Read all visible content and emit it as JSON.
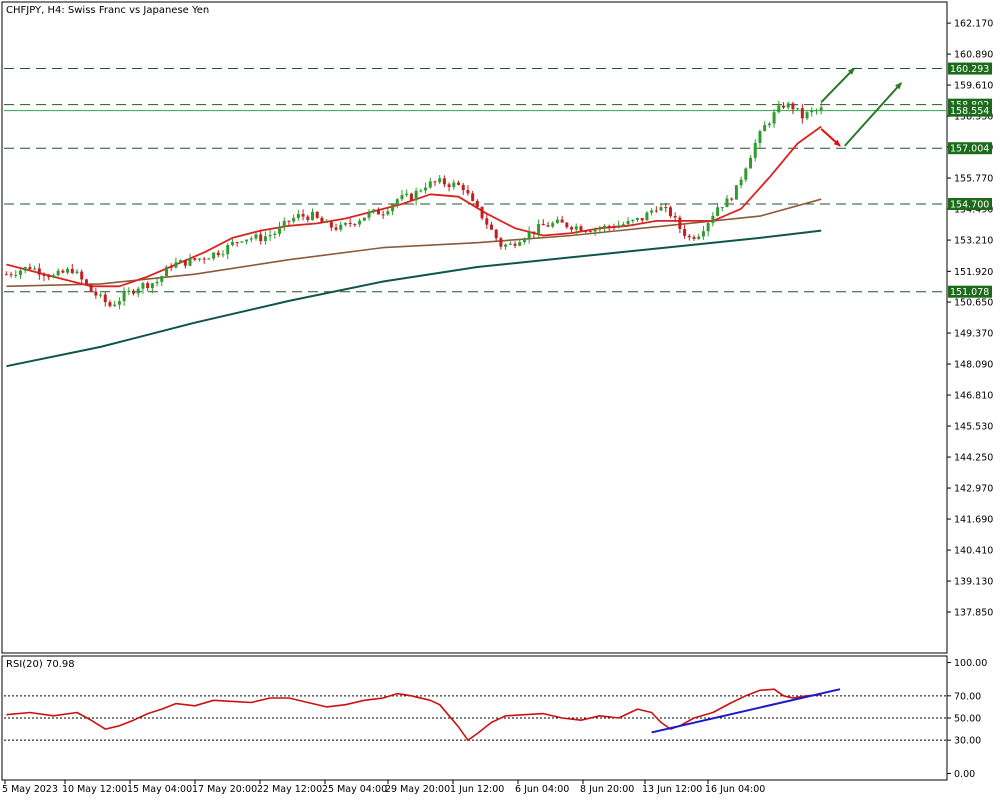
{
  "header": {
    "title": "CHFJPY, H4:  Swiss Franc vs Japanese Yen",
    "rsi_label": "RSI(20) 70.98"
  },
  "colors": {
    "bull": "#2e9d2e",
    "bear": "#c41e1e",
    "ma_fast": "#dd2222",
    "ma_mid": "#8b5a3c",
    "ma_slow": "#11544a",
    "level_line": "#1f5a2a",
    "level_label_bg": "#1b6b1b",
    "rsi_line": "#cc1111",
    "trend_line": "#1a1acc",
    "arrow_up": "#2a7a2a",
    "arrow_down": "#dd1111",
    "current_price_line": "#2fa64a"
  },
  "chart_data": {
    "type": "candlestick",
    "symbol": "CHFJPY",
    "timeframe": "H4",
    "ylim": [
      136.2,
      163.0
    ],
    "y_ticks": [
      "162.170",
      "160.890",
      "159.610",
      "158.330",
      "157.050",
      "155.770",
      "154.490",
      "153.210",
      "151.920",
      "150.650",
      "149.370",
      "148.090",
      "146.810",
      "145.530",
      "144.250",
      "142.970",
      "141.690",
      "140.410",
      "139.130",
      "137.850"
    ],
    "x_ticks": [
      "5 May 2023",
      "10 May 12:00",
      "15 May 04:00",
      "17 May 20:00",
      "22 May 12:00",
      "25 May 04:00",
      "29 May 20:00",
      "1 Jun 12:00",
      "6 Jun 04:00",
      "8 Jun 20:00",
      "13 Jun 12:00",
      "16 Jun 04:00"
    ],
    "levels": [
      {
        "value": 160.293,
        "label": "160.293"
      },
      {
        "value": 158.802,
        "label": "158.802"
      },
      {
        "value": 157.004,
        "label": "157.004"
      },
      {
        "value": 154.7,
        "label": "154.700"
      },
      {
        "value": 151.078,
        "label": "151.078"
      }
    ],
    "current_price": {
      "value": 158.554,
      "label": "158.554"
    },
    "close_path": [
      [
        0,
        151.8
      ],
      [
        5,
        152.1
      ],
      [
        10,
        151.7
      ],
      [
        14,
        152.0
      ],
      [
        18,
        151.1
      ],
      [
        22,
        150.5
      ],
      [
        25,
        150.9
      ],
      [
        28,
        151.3
      ],
      [
        32,
        151.5
      ],
      [
        35,
        152.2
      ],
      [
        38,
        152.3
      ],
      [
        42,
        152.5
      ],
      [
        46,
        152.8
      ],
      [
        50,
        153.3
      ],
      [
        54,
        153.3
      ],
      [
        57,
        153.5
      ],
      [
        60,
        154.0
      ],
      [
        62,
        154.2
      ],
      [
        65,
        154.2
      ],
      [
        68,
        153.8
      ],
      [
        71,
        153.7
      ],
      [
        74,
        154.0
      ],
      [
        77,
        154.3
      ],
      [
        80,
        154.4
      ],
      [
        83,
        154.9
      ],
      [
        86,
        155.0
      ],
      [
        89,
        155.5
      ],
      [
        92,
        155.6
      ],
      [
        95,
        155.5
      ],
      [
        97,
        155.4
      ],
      [
        99,
        154.7
      ],
      [
        101,
        154.2
      ],
      [
        103,
        153.6
      ],
      [
        105,
        153.0
      ],
      [
        107,
        153.0
      ],
      [
        109,
        153.3
      ],
      [
        111,
        153.5
      ],
      [
        114,
        153.8
      ],
      [
        117,
        153.9
      ],
      [
        120,
        153.8
      ],
      [
        123,
        153.7
      ],
      [
        126,
        153.7
      ],
      [
        129,
        153.8
      ],
      [
        132,
        153.9
      ],
      [
        135,
        154.1
      ],
      [
        138,
        154.6
      ],
      [
        141,
        154.3
      ],
      [
        143,
        153.7
      ],
      [
        145,
        153.3
      ],
      [
        147,
        153.5
      ],
      [
        149,
        154.0
      ],
      [
        151,
        154.6
      ],
      [
        153,
        154.8
      ],
      [
        155,
        155.3
      ],
      [
        157,
        156.3
      ],
      [
        159,
        157.2
      ],
      [
        161,
        157.9
      ],
      [
        163,
        158.4
      ],
      [
        165,
        158.8
      ],
      [
        167,
        158.7
      ],
      [
        169,
        158.3
      ],
      [
        171,
        158.5
      ],
      [
        173,
        158.6
      ]
    ],
    "ma_fast": [
      [
        0,
        152.2
      ],
      [
        6,
        151.9
      ],
      [
        12,
        151.6
      ],
      [
        18,
        151.3
      ],
      [
        24,
        151.3
      ],
      [
        30,
        151.7
      ],
      [
        36,
        152.2
      ],
      [
        42,
        152.7
      ],
      [
        48,
        153.3
      ],
      [
        54,
        153.6
      ],
      [
        60,
        153.8
      ],
      [
        66,
        153.9
      ],
      [
        72,
        154.1
      ],
      [
        78,
        154.4
      ],
      [
        84,
        154.7
      ],
      [
        90,
        155.1
      ],
      [
        96,
        155.0
      ],
      [
        102,
        154.3
      ],
      [
        108,
        153.7
      ],
      [
        114,
        153.4
      ],
      [
        120,
        153.5
      ],
      [
        126,
        153.7
      ],
      [
        132,
        153.8
      ],
      [
        138,
        154.0
      ],
      [
        144,
        154.0
      ],
      [
        150,
        154.0
      ],
      [
        156,
        154.5
      ],
      [
        162,
        155.8
      ],
      [
        168,
        157.2
      ],
      [
        173,
        157.9
      ]
    ],
    "ma_mid": [
      [
        0,
        151.3
      ],
      [
        20,
        151.4
      ],
      [
        40,
        151.8
      ],
      [
        60,
        152.4
      ],
      [
        80,
        152.9
      ],
      [
        100,
        153.1
      ],
      [
        120,
        153.4
      ],
      [
        140,
        153.8
      ],
      [
        150,
        154.0
      ],
      [
        160,
        154.2
      ],
      [
        173,
        154.9
      ]
    ],
    "ma_slow": [
      [
        0,
        148.0
      ],
      [
        20,
        148.8
      ],
      [
        40,
        149.8
      ],
      [
        60,
        150.7
      ],
      [
        80,
        151.5
      ],
      [
        100,
        152.1
      ],
      [
        120,
        152.5
      ],
      [
        140,
        152.9
      ],
      [
        160,
        153.3
      ],
      [
        173,
        153.6
      ]
    ],
    "arrows": [
      {
        "color": "up",
        "from": [
          173,
          158.9
        ],
        "to": [
          180,
          160.3
        ]
      },
      {
        "color": "down",
        "from": [
          173,
          157.8
        ],
        "to": [
          177,
          157.1
        ]
      },
      {
        "color": "up",
        "from": [
          178,
          157.1
        ],
        "to": [
          190,
          159.7
        ]
      }
    ],
    "rsi": {
      "period": 20,
      "value": 70.98,
      "ylim": [
        -5,
        105
      ],
      "y_ticks": [
        "100.00",
        "70.00",
        "50.00",
        "30.00",
        "0.00"
      ],
      "levels": [
        70,
        50,
        30
      ],
      "path": [
        [
          0,
          53
        ],
        [
          5,
          55
        ],
        [
          10,
          52
        ],
        [
          15,
          55
        ],
        [
          18,
          48
        ],
        [
          21,
          40
        ],
        [
          24,
          43
        ],
        [
          27,
          48
        ],
        [
          30,
          54
        ],
        [
          33,
          58
        ],
        [
          36,
          63
        ],
        [
          40,
          61
        ],
        [
          44,
          66
        ],
        [
          48,
          65
        ],
        [
          52,
          64
        ],
        [
          56,
          68
        ],
        [
          60,
          68
        ],
        [
          64,
          64
        ],
        [
          68,
          60
        ],
        [
          72,
          62
        ],
        [
          76,
          66
        ],
        [
          80,
          68
        ],
        [
          83,
          72
        ],
        [
          86,
          70
        ],
        [
          90,
          66
        ],
        [
          92,
          62
        ],
        [
          94,
          52
        ],
        [
          96,
          42
        ],
        [
          98,
          30
        ],
        [
          100,
          36
        ],
        [
          103,
          46
        ],
        [
          106,
          52
        ],
        [
          110,
          53
        ],
        [
          114,
          54
        ],
        [
          118,
          50
        ],
        [
          122,
          48
        ],
        [
          126,
          52
        ],
        [
          130,
          50
        ],
        [
          134,
          58
        ],
        [
          137,
          55
        ],
        [
          139,
          46
        ],
        [
          141,
          40
        ],
        [
          143,
          43
        ],
        [
          146,
          50
        ],
        [
          150,
          55
        ],
        [
          154,
          64
        ],
        [
          157,
          70
        ],
        [
          160,
          75
        ],
        [
          163,
          76
        ],
        [
          165,
          70
        ],
        [
          167,
          68
        ],
        [
          170,
          70
        ],
        [
          173,
          71
        ]
      ],
      "trend": {
        "from": [
          137,
          37
        ],
        "to": [
          177,
          76
        ]
      }
    }
  }
}
